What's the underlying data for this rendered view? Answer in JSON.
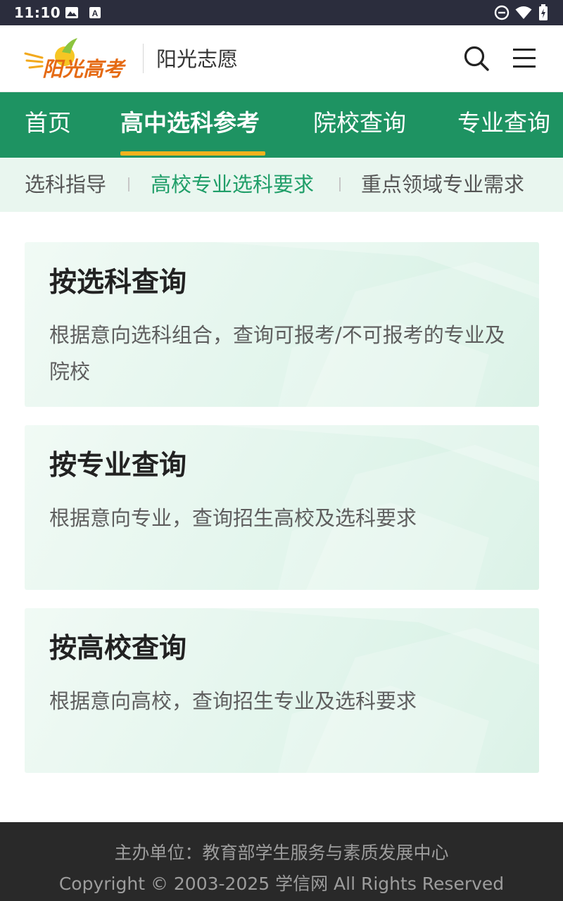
{
  "status_bar": {
    "time": "11:10",
    "icons_left": [
      "image-icon",
      "font-a-icon"
    ],
    "icons_right": [
      "do-not-disturb-icon",
      "wifi-icon",
      "battery-icon"
    ]
  },
  "header": {
    "logo_text": "阳光高考",
    "subtitle": "阳光志愿",
    "icons": [
      "search-icon",
      "menu-icon"
    ]
  },
  "main_nav": {
    "tabs": [
      {
        "label": "首页",
        "active": false
      },
      {
        "label": "高中选科参考",
        "active": true
      },
      {
        "label": "院校查询",
        "active": false
      },
      {
        "label": "专业查询",
        "active": false
      }
    ]
  },
  "sub_nav": {
    "tabs": [
      {
        "label": "选科指导",
        "active": false
      },
      {
        "label": "高校专业选科要求",
        "active": true
      },
      {
        "label": "重点领域专业需求",
        "active": false
      }
    ],
    "separator": "|"
  },
  "cards": [
    {
      "title": "按选科查询",
      "description": "根据意向选科组合，查询可报考/不可报考的专业及院校"
    },
    {
      "title": "按专业查询",
      "description": "根据意向专业，查询招生高校及选科要求"
    },
    {
      "title": "按高校查询",
      "description": "根据意向高校，查询招生专业及选科要求"
    }
  ],
  "footer": {
    "organizer": "主办单位：教育部学生服务与素质发展中心",
    "copyright": "Copyright © 2003-2025 学信网 All Rights Reserved"
  },
  "colors": {
    "status_bar_bg": "#2b2d3d",
    "nav_green": "#1e9362",
    "active_underline": "#f5b21d",
    "subnav_bg": "#e9f6ef",
    "subnav_active": "#1f9e68",
    "footer_bg": "#292929"
  }
}
